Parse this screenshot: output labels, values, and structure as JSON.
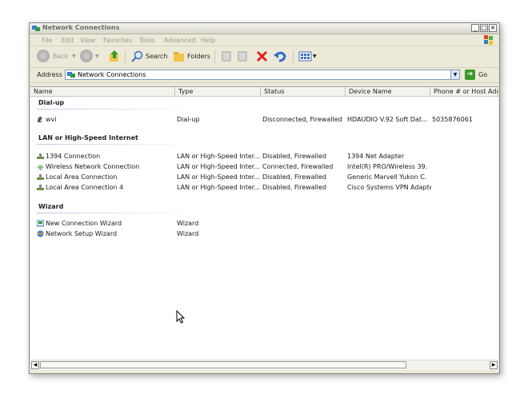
{
  "window": {
    "title": "Network Connections"
  },
  "menu": [
    "File",
    "Edit",
    "View",
    "Favorites",
    "Tools",
    "Advanced",
    "Help"
  ],
  "toolbar": {
    "back": "Back",
    "search": "Search",
    "folders": "Folders"
  },
  "address": {
    "label": "Address",
    "value": "Network Connections",
    "go": "Go"
  },
  "columns": [
    "Name",
    "Type",
    "Status",
    "Device Name",
    "Phone # or Host Addre"
  ],
  "groups": [
    {
      "title": "Dial-up",
      "rows": [
        {
          "name": "wvi",
          "icon": "dialup-icon",
          "type": "Dial-up",
          "status": "Disconnected, Firewalled",
          "device": "HDAUDIO V.92 Soft Dat...",
          "phone": "5035876061"
        }
      ]
    },
    {
      "title": "LAN or High-Speed Internet",
      "rows": [
        {
          "name": "1394 Connection",
          "icon": "lan-icon",
          "type": "LAN or High-Speed Inter...",
          "status": "Disabled, Firewalled",
          "device": "1394 Net Adapter",
          "phone": ""
        },
        {
          "name": "Wireless Network Connection",
          "icon": "wireless-icon",
          "type": "LAN or High-Speed Inter...",
          "status": "Connected, Firewalled",
          "device": "Intel(R) PRO/Wireless 39...",
          "phone": ""
        },
        {
          "name": "Local Area Connection",
          "icon": "lan-icon",
          "type": "LAN or High-Speed Inter...",
          "status": "Disabled, Firewalled",
          "device": "Generic Marvell Yukon C...",
          "phone": ""
        },
        {
          "name": "Local Area Connection 4",
          "icon": "lan-icon",
          "type": "LAN or High-Speed Inter...",
          "status": "Disabled, Firewalled",
          "device": "Cisco Systems VPN Adapter",
          "phone": ""
        }
      ]
    },
    {
      "title": "Wizard",
      "rows": [
        {
          "name": "New Connection Wizard",
          "icon": "wizard-icon",
          "type": "Wizard",
          "status": "",
          "device": "",
          "phone": ""
        },
        {
          "name": "Network Setup Wizard",
          "icon": "setup-wizard-icon",
          "type": "Wizard",
          "status": "",
          "device": "",
          "phone": ""
        }
      ]
    }
  ],
  "colors": {
    "accent": "#3a7bd5",
    "go_button": "#3a9a2a",
    "delete_red": "#e02020"
  }
}
